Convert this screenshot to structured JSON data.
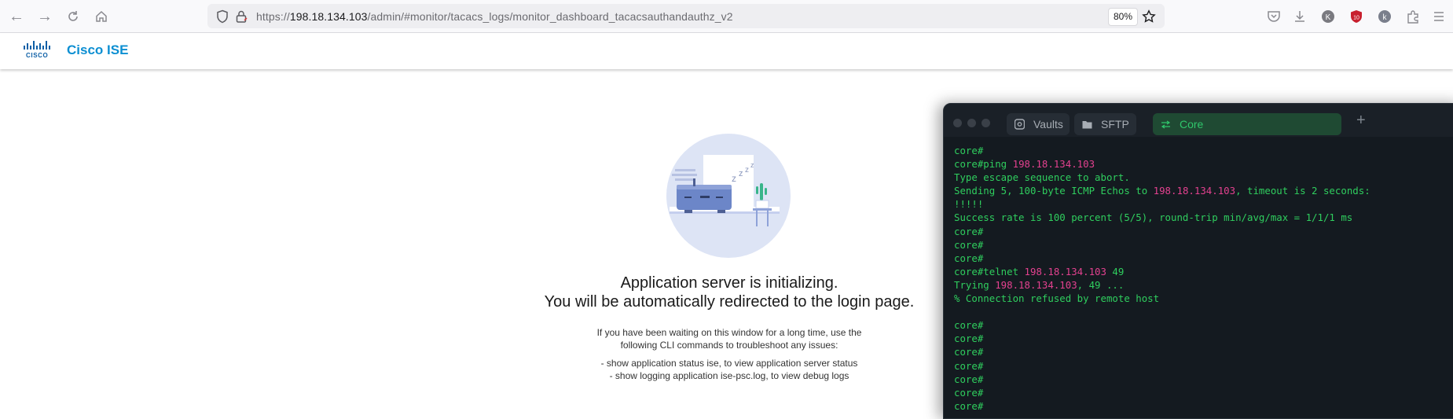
{
  "browser": {
    "url_prefix": "https://",
    "url_host": "198.18.134.103",
    "url_path": "/admin/#monitor/tacacs_logs/monitor_dashboard_tacacsauthandauthz_v2",
    "zoom": "80%"
  },
  "app": {
    "logo_text": "CISCO",
    "title": "Cisco ISE"
  },
  "loading": {
    "heading_line1": "Application server is initializing.",
    "heading_line2": "You will be automatically redirected to the login page.",
    "help_line1": "If you have been waiting on this window for a long time, use the",
    "help_line2": "following CLI commands to troubleshoot any issues:",
    "cmd1": "- show application status ise, to view application server status",
    "cmd2": "- show logging application ise-psc.log, to view debug logs"
  },
  "terminal": {
    "tabs": [
      {
        "label": "Vaults",
        "icon": "vault-icon"
      },
      {
        "label": "SFTP",
        "icon": "folder-icon"
      },
      {
        "label": "Core",
        "icon": "swap-arrows-icon"
      }
    ],
    "lines": [
      [
        "core#"
      ],
      [
        "core#ping ",
        "198.18.134.103"
      ],
      [
        "Type escape sequence to abort."
      ],
      [
        "Sending 5, 100-byte ICMP Echos to ",
        "198.18.134.103",
        ", timeout is 2 seconds:"
      ],
      [
        "!!!!!"
      ],
      [
        "Success rate is 100 percent (5/5), round-trip min/avg/max = 1/1/1 ms"
      ],
      [
        "core#"
      ],
      [
        "core#"
      ],
      [
        "core#"
      ],
      [
        "core#telnet ",
        "198.18.134.103",
        " 49"
      ],
      [
        "Trying ",
        "198.18.134.103",
        ", 49 ..."
      ],
      [
        "% Connection refused by remote host"
      ],
      [
        ""
      ],
      [
        "core#"
      ],
      [
        "core#"
      ],
      [
        "core#"
      ],
      [
        "core#"
      ],
      [
        "core#"
      ],
      [
        "core#"
      ],
      [
        "core#"
      ]
    ],
    "colors": {
      "text": "#2fce5e",
      "ip": "#e3418f",
      "bg": "#141a20"
    }
  }
}
